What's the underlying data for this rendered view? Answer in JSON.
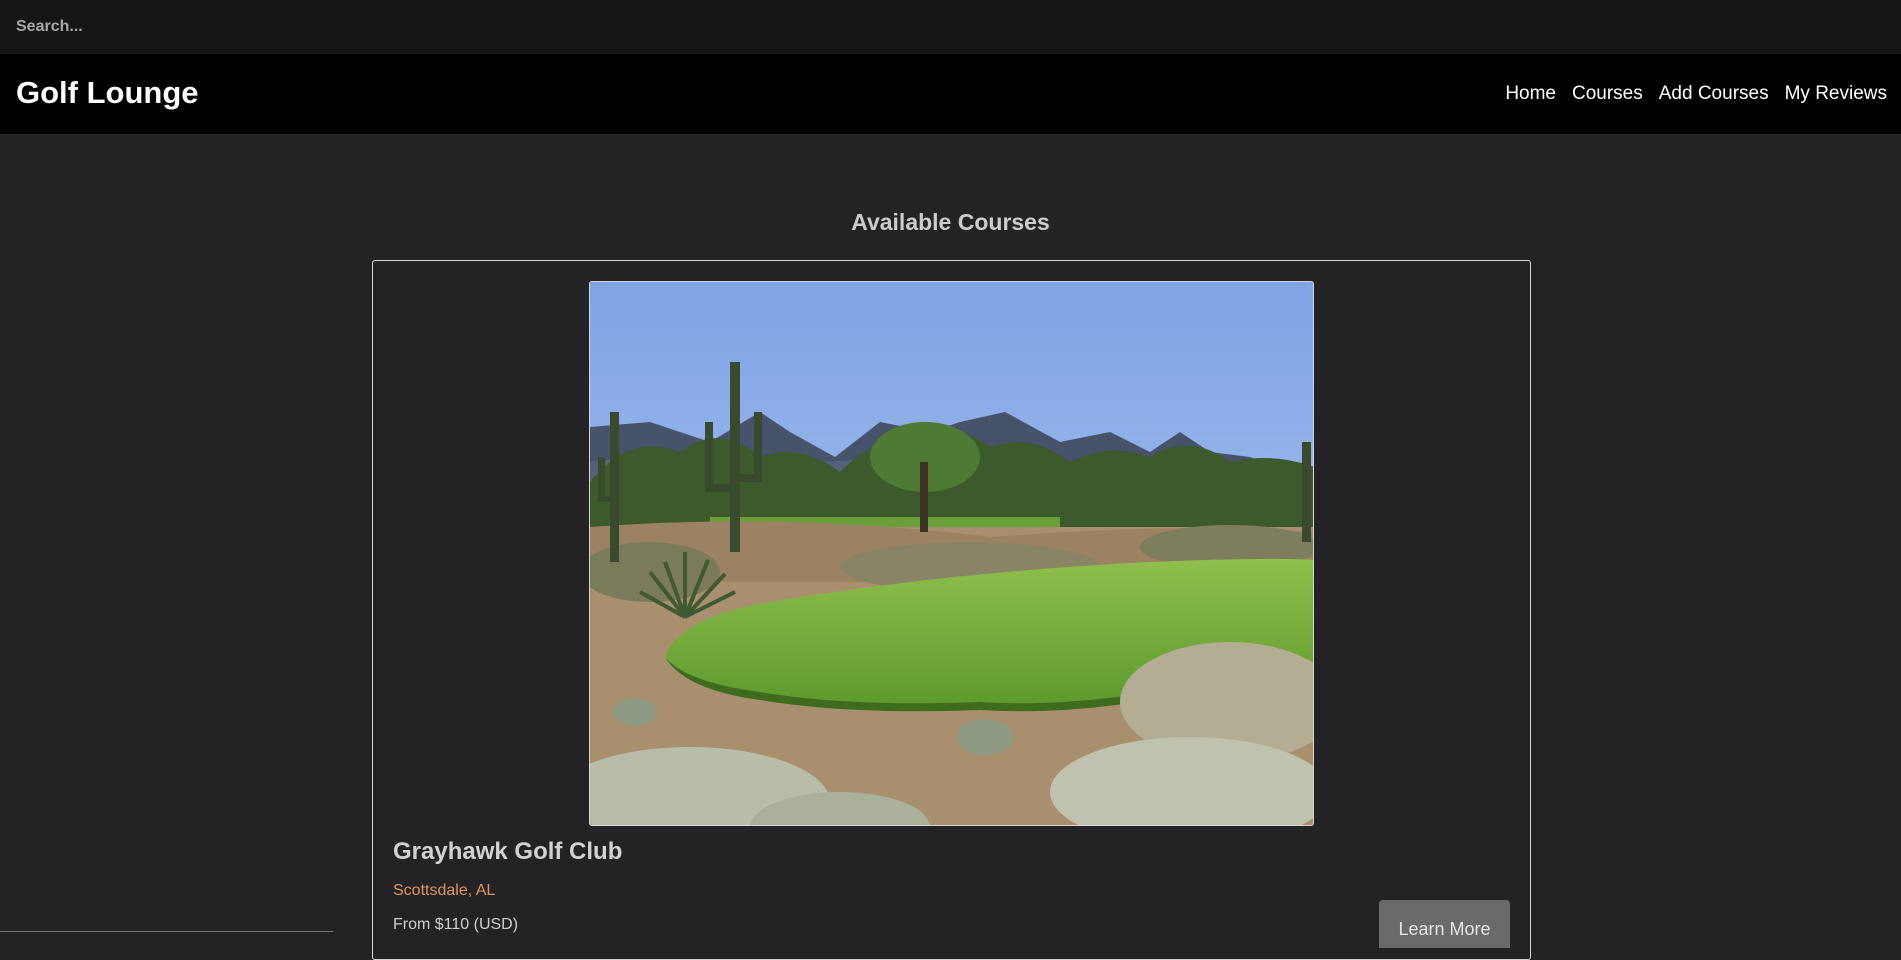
{
  "search": {
    "placeholder": "Search..."
  },
  "navbar": {
    "brand": "Golf Lounge",
    "links": [
      {
        "label": "Home"
      },
      {
        "label": "Courses"
      },
      {
        "label": "Add Courses"
      },
      {
        "label": "My Reviews"
      }
    ]
  },
  "main": {
    "title": "Available Courses",
    "courses": [
      {
        "name": "Grayhawk Golf Club",
        "location": "Scottsdale, AL",
        "price": "From $110 (USD)",
        "button_label": "Learn More"
      }
    ]
  },
  "colors": {
    "page_background": "#232325",
    "search_background": "#151515",
    "navbar_background": "#000000",
    "location_accent": "#e0955c",
    "button_background": "#6a6a6b"
  }
}
